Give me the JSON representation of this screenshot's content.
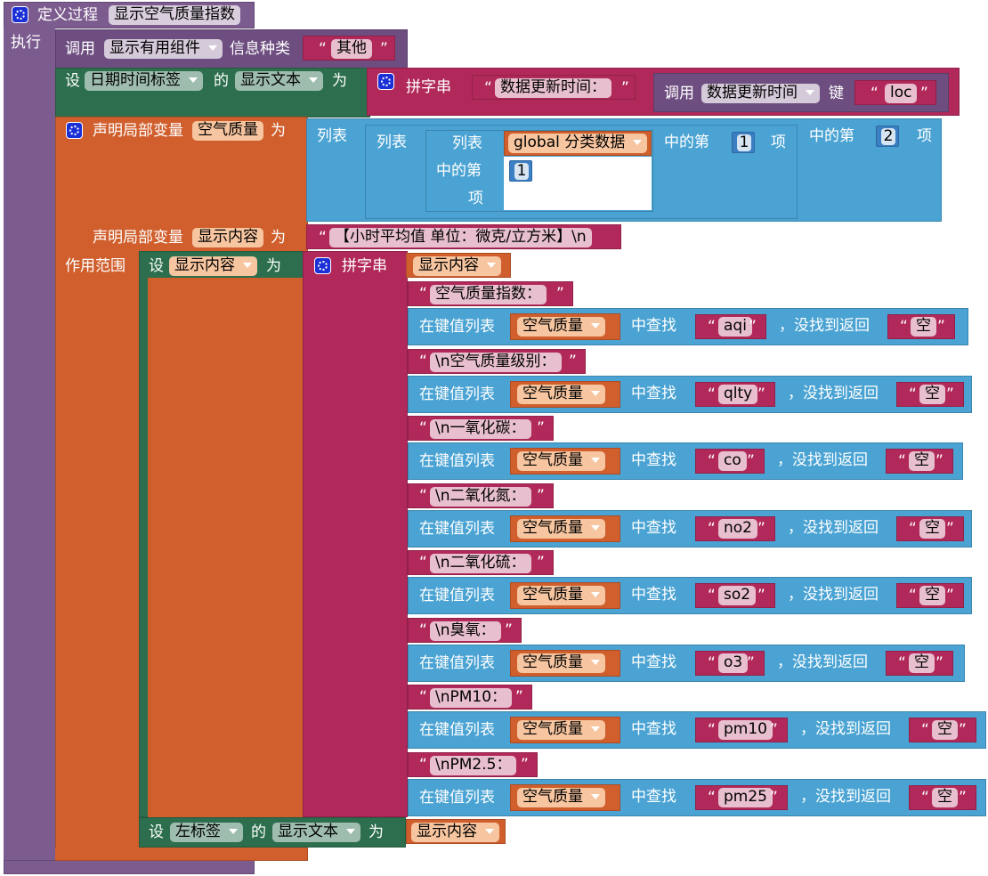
{
  "procedure": {
    "define_label": "定义过程",
    "name": "显示空气质量指数",
    "do_label": "执行"
  },
  "call_block": {
    "call_label": "调用",
    "proc_name": "显示有用组件",
    "param_label": "信息种类",
    "param_value": "其他"
  },
  "set_time": {
    "set_label": "设",
    "component": "日期时间标签",
    "of_label": "的",
    "property": "显示文本",
    "to_label": "为",
    "join_label": "拼字串",
    "str1": "数据更新时间：",
    "call_label": "调用",
    "call_proc": "数据更新时间",
    "key_label": "键",
    "key_value": "loc"
  },
  "local1": {
    "declare_label": "声明局部变量",
    "var_name": "空气质量",
    "to_label": "为",
    "list_label": "列表",
    "global_var": "global 分类数据",
    "index_of_label": "中的第",
    "item_label": "项",
    "idx_inner_a": "1",
    "idx_inner_b": "1",
    "idx_outer": "2"
  },
  "local2": {
    "declare_label": "声明局部变量",
    "var_name": "显示内容",
    "to_label": "为",
    "init_value": "【小时平均值  单位：微克/立方米】\\n"
  },
  "scope": {
    "scope_label": "作用范围",
    "set_label": "设",
    "var_ref": "显示内容",
    "to_label": "为",
    "join_label": "拼字串",
    "first_ref": "显示内容"
  },
  "lookup_labels": {
    "in_list": "在键值列表",
    "find": "中查找",
    "not_found": "，没找到返回",
    "dict_var": "空气质量",
    "default": "空"
  },
  "rows": [
    {
      "label": "空气质量指数：",
      "key": "aqi"
    },
    {
      "label": "\\n空气质量级别：",
      "key": "qlty"
    },
    {
      "label": "\\n一氧化碳：",
      "key": "co"
    },
    {
      "label": "\\n二氧化氮：",
      "key": "no2"
    },
    {
      "label": "\\n二氧化硫：",
      "key": "so2"
    },
    {
      "label": "\\n臭氧：",
      "key": "o3"
    },
    {
      "label": "\\nPM10：",
      "key": "pm10"
    },
    {
      "label": "\\nPM2.5：",
      "key": "pm25"
    }
  ],
  "final_set": {
    "set_label": "设",
    "component": "左标签",
    "of_label": "的",
    "property": "显示文本",
    "to_label": "为",
    "value_ref": "显示内容"
  },
  "colors": {
    "procedure": "#7c5b8e",
    "setter": "#2c6e4d",
    "variable": "#d05f2d",
    "text": "#b1295a",
    "list": "#4aa3d3",
    "number": "#3a7fc4"
  }
}
